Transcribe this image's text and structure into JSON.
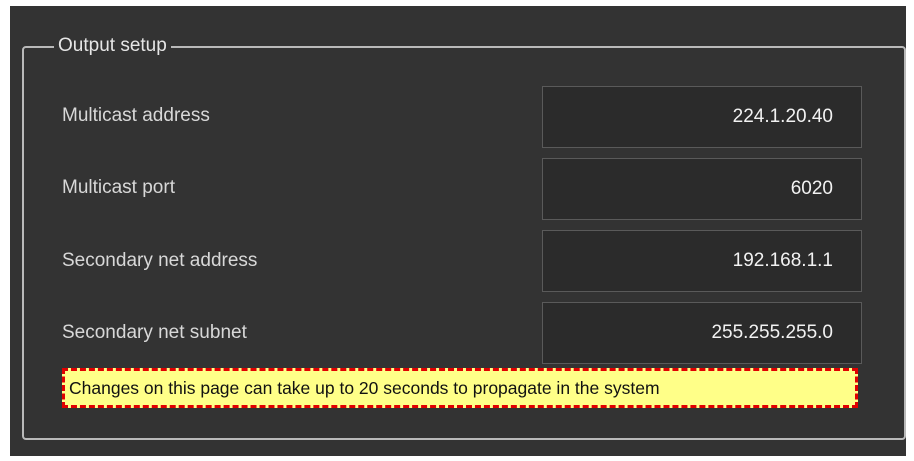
{
  "group": {
    "title": "Output setup"
  },
  "fields": [
    {
      "label": "Multicast address",
      "value": "224.1.20.40"
    },
    {
      "label": "Multicast port",
      "value": "6020"
    },
    {
      "label": "Secondary net address",
      "value": "192.168.1.1"
    },
    {
      "label": "Secondary net subnet",
      "value": "255.255.255.0"
    }
  ],
  "notice": "Changes on this page can take up to 20 seconds to propagate in the system",
  "colors": {
    "panel_background": "#333333",
    "field_background": "#2b2b2b",
    "notice_background": "#ffff88",
    "notice_border": "#e00000"
  }
}
